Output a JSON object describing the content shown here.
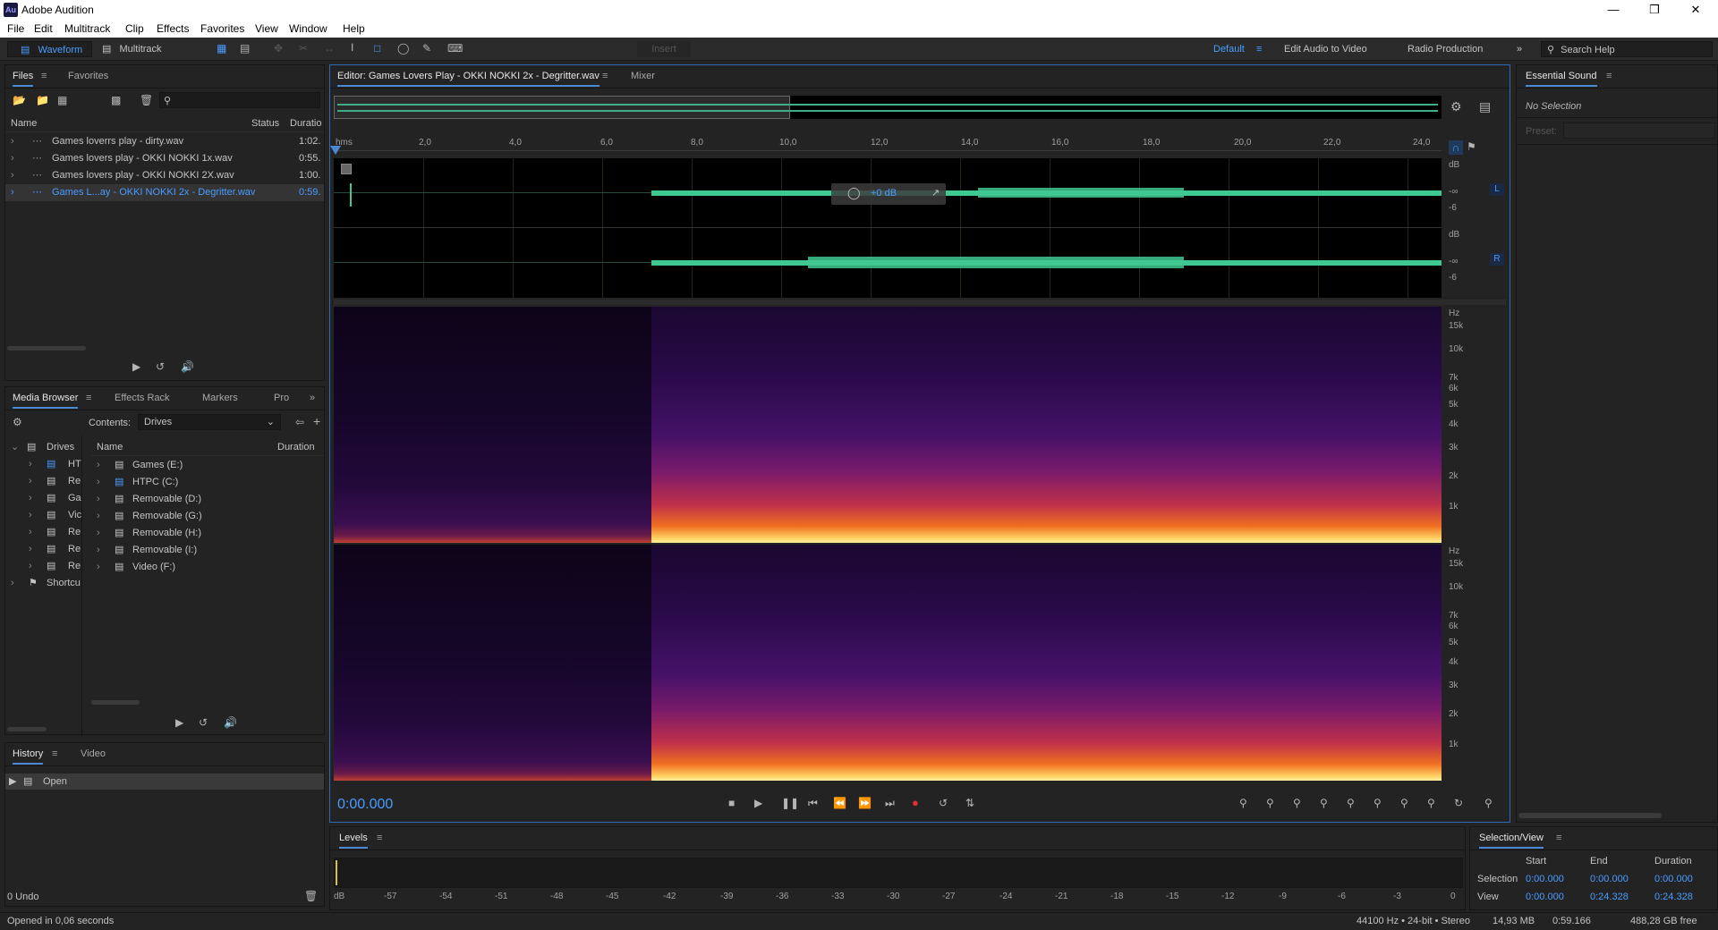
{
  "window": {
    "app_icon": "Au",
    "title": "Adobe Audition",
    "controls": [
      "minimize-icon",
      "maximize-icon",
      "close-icon"
    ]
  },
  "menu": [
    "File",
    "Edit",
    "Multitrack",
    "Clip",
    "Effects",
    "Favorites",
    "View",
    "Window",
    "Help"
  ],
  "toolbar": {
    "waveform_label": "Waveform",
    "multitrack_label": "Multitrack",
    "insert_label": "Insert",
    "workspaces": [
      "Default",
      "Edit Audio to Video",
      "Radio Production"
    ],
    "search_placeholder": "Search Help"
  },
  "files_panel": {
    "tabs": [
      "Files",
      "Favorites"
    ],
    "columns": [
      "Name",
      "Status",
      "Duratio"
    ],
    "rows": [
      {
        "name": "Games loverrs play - dirty.wav",
        "duration": "1:02."
      },
      {
        "name": "Games lovers play - OKKI NOKKI 1x.wav",
        "duration": "0:55."
      },
      {
        "name": "Games lovers play - OKKI NOKKI 2X.wav",
        "duration": "1:00."
      },
      {
        "name": "Games L...ay - OKKI NOKKI 2x - Degritter.wav",
        "duration": "0:59."
      }
    ]
  },
  "media_browser": {
    "tabs": [
      "Media Browser",
      "Effects Rack",
      "Markers",
      "Pro"
    ],
    "contents_label": "Contents:",
    "contents_value": "Drives",
    "tree": [
      "Drives",
      "HT",
      "Re",
      "Ga",
      "Vic",
      "Re",
      "Re",
      "Re",
      "Shortcu"
    ],
    "columns": [
      "Name",
      "Duration"
    ],
    "drives": [
      "Games (E:)",
      "HTPC (C:)",
      "Removable (D:)",
      "Removable (G:)",
      "Removable (H:)",
      "Removable (I:)",
      "Video (F:)"
    ]
  },
  "history_panel": {
    "tabs": [
      "History",
      "Video"
    ],
    "items": [
      "Open"
    ],
    "undo_label": "0 Undo"
  },
  "editor": {
    "tabs": [
      "Editor: Games Lovers Play - OKKI NOKKI 2x - Degritter.wav",
      "Mixer"
    ],
    "ruler": [
      "hms",
      "2,0",
      "4,0",
      "6,0",
      "8,0",
      "10,0",
      "12,0",
      "14,0",
      "16,0",
      "18,0",
      "20,0",
      "22,0",
      "24,0"
    ],
    "hud_value": "+0 dB",
    "channel_labels": [
      "L",
      "R"
    ],
    "db_labels": [
      "dB",
      "-∞",
      "-6"
    ],
    "hz_labels": [
      "Hz",
      "15k",
      "10k",
      "7k",
      "6k",
      "5k",
      "4k",
      "3k",
      "2k",
      "1k"
    ],
    "timecode": "0:00.000"
  },
  "levels": {
    "title": "Levels",
    "scale": [
      "dB",
      "-57",
      "-54",
      "-51",
      "-48",
      "-45",
      "-42",
      "-39",
      "-36",
      "-33",
      "-30",
      "-27",
      "-24",
      "-21",
      "-18",
      "-15",
      "-12",
      "-9",
      "-6",
      "-3",
      "0"
    ]
  },
  "essential_sound": {
    "title": "Essential Sound",
    "no_selection": "No Selection",
    "preset_label": "Preset:"
  },
  "selection_view": {
    "title": "Selection/View",
    "headers": [
      "Start",
      "End",
      "Duration"
    ],
    "selection_label": "Selection",
    "selection": [
      "0:00.000",
      "0:00.000",
      "0:00.000"
    ],
    "view_label": "View",
    "view": [
      "0:00.000",
      "0:24.328",
      "0:24.328"
    ]
  },
  "status": {
    "left": "Opened in 0,06 seconds",
    "format": "44100 Hz • 24-bit • Stereo",
    "size": "14,93 MB",
    "duration": "0:59.166",
    "free": "488,28 GB free"
  }
}
